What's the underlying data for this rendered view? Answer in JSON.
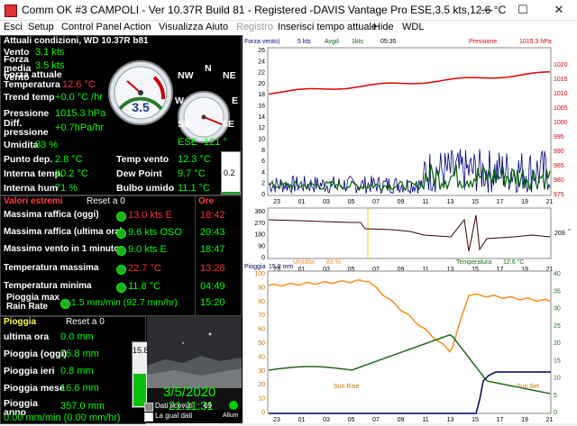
{
  "window": {
    "title": "Comm OK  #3 CAMPOLI - Ver 10.37R Build 81 - Registered  -DAVIS Vantage Pro ESE,3.5 kts,12.6 °C",
    "minimize": "—",
    "maximize": "☐",
    "close": "✕"
  },
  "menu": [
    "Esci",
    "Setup",
    "Control Panel",
    "Action",
    "Visualizza",
    "Aiuto",
    "Registro",
    "Inserisci tempo attuale",
    "Hide",
    "WDL"
  ],
  "current": {
    "header": "Attuali condizioni, WD 10.37R b81",
    "rows": [
      {
        "label": "Vento",
        "value": "3.1 kts"
      },
      {
        "label": "Forza media Vento",
        "value": "3.5 kts"
      },
      {
        "label": "Forza attuale",
        "value": ""
      },
      {
        "label": "Temperatura",
        "value": "12.6 °C"
      },
      {
        "label": "Trend temp",
        "value": "+0.0 °C /hr"
      },
      {
        "label": "Pressione",
        "value": "1015.3 hPa"
      },
      {
        "label": "Diff. pressione",
        "value": "+0.7hPa/hr"
      },
      {
        "label": "Umidita",
        "value": "83 %"
      }
    ],
    "pair_rows": [
      {
        "l1": "Punto dep.",
        "v1": "2.8 °C",
        "l2": "Temp vento",
        "v2": "12.3 °C"
      },
      {
        "l1": "Interna temp.",
        "v1": "20.2 °C",
        "l2": "Dew Point",
        "v2": "9.7 °C"
      },
      {
        "l1": "Interna hum",
        "v1": "71 %",
        "l2": "Bulbo umido",
        "v2": "11.1 °C"
      }
    ],
    "gauge_value": "3.5",
    "compass": {
      "n": "N",
      "ne": "NE",
      "nw": "NW",
      "w": "W",
      "e": "E",
      "sw": "SW",
      "se": "SE",
      "s": "S"
    },
    "direction": "ESE",
    "degrees": "121 °",
    "side_value": "0.2"
  },
  "extremes": {
    "header": "Valori estremi",
    "reset": "Reset a 0",
    "ore_header": "Ore",
    "rows": [
      {
        "label": "Massima raffica (oggi)",
        "value": "13.0 kts E",
        "time": "18:42",
        "red": true
      },
      {
        "label": "Massima raffica (ultima ora)",
        "value": "9.6 kts OSO",
        "time": "20:43",
        "red": false
      },
      {
        "label": "Massimo vento in 1 minuto",
        "value": "9.0 kts E",
        "time": "18:47",
        "red": false
      },
      {
        "label": "Temperatura massima",
        "value": "22.7 °C",
        "time": "13:28",
        "red": true
      },
      {
        "label": "Temperatura minima",
        "value": "11.8 °C",
        "time": "04:49",
        "red": false
      },
      {
        "label": "Pioggia max Rain Rate",
        "value": "1.5 mm/min (92.7 mm/hr)",
        "time": "15:20",
        "red": false
      }
    ]
  },
  "rain": {
    "header": "Pioggia",
    "reset": "Reset a 0",
    "rows": [
      {
        "label": "ultima ora",
        "value": "0.0 mm"
      },
      {
        "label": "Pioggia (oggi)",
        "value": "15.8 mm"
      },
      {
        "label": "Pioggia ieri",
        "value": "0.8 mm"
      },
      {
        "label": "Pioggia mese",
        "value": "16.6 mm"
      },
      {
        "label": "Pioggia anno",
        "value": "357.0 mm"
      }
    ],
    "rate": "0.00 mm/min (0.00 mm/hr)",
    "bar_label": "15.8",
    "date": "3/5/2020",
    "time": "21:11:31",
    "data_received_label": "Dati ricevuti",
    "data_received_count": "69",
    "bad_data_label": "La gual dati",
    "alarm_label": "Allum"
  },
  "chart1": {
    "legend_wind": "Forza vento)",
    "legend_wind_val": "5 kts",
    "legend_avg": "Avgd",
    "legend_avg_val": "1kts",
    "legend_time": "05:35",
    "legend_pressure": "Pressione",
    "legend_pressure_val": "1015.3 hPa",
    "left_ticks": [
      "26",
      "24",
      "22",
      "20",
      "18",
      "16",
      "14",
      "12",
      "10",
      "8",
      "6",
      "4",
      "2",
      "0"
    ],
    "right_ticks": [
      "1020",
      "1015",
      "1010",
      "1005",
      "1000",
      "995",
      "990",
      "985",
      "980",
      "975"
    ],
    "x_ticks": [
      "23",
      "01",
      "03",
      "05",
      "07",
      "09",
      "11",
      "13",
      "15",
      "17",
      "19",
      "21"
    ]
  },
  "chart2": {
    "left_ticks": [
      "360",
      "270",
      "180",
      "90",
      "0"
    ],
    "right_label": "209",
    "right_unit": "°",
    "legend_humidity": "Umidita",
    "legend_humidity_val": "83 %",
    "legend_temp": "Temperatura",
    "legend_temp_val": "12.6 °C",
    "x_ticks": [
      "23",
      "01",
      "03",
      "05",
      "07",
      "09",
      "11",
      "13",
      "15",
      "17",
      "19",
      "21"
    ]
  },
  "chart3": {
    "legend_rain": "Pioggia",
    "legend_rain_val": "15.8 mm",
    "left_ticks": [
      "100",
      "90",
      "80",
      "70",
      "60",
      "50",
      "40",
      "30",
      "20",
      "10",
      "0"
    ],
    "right_ticks": [
      "40",
      "35",
      "30",
      "25",
      "20",
      "15",
      "10",
      "5",
      "0"
    ],
    "sunrise": "Sun Rise",
    "sunset": "Sun Set",
    "x_ticks": [
      "23",
      "01",
      "03",
      "05",
      "07",
      "09",
      "11",
      "13",
      "15",
      "17",
      "19",
      "21"
    ]
  },
  "colors": {
    "wind": "#000080",
    "wind_avg": "#006400",
    "pressure": "#e00000",
    "humidity": "#ff8c1a",
    "temperature": "#1a6b1a",
    "rain": "#000060",
    "direction": "#3a0000"
  }
}
